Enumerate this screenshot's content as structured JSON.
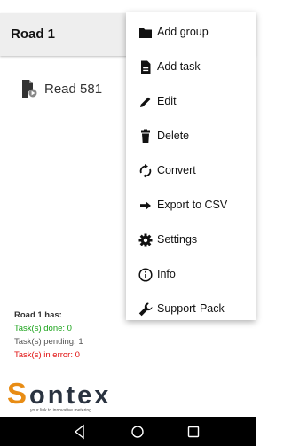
{
  "header": {
    "title": "Road 1"
  },
  "list": {
    "items": [
      {
        "label": "Read 581",
        "icon": "file-play-icon"
      }
    ]
  },
  "summary": {
    "heading": "Road 1  has:",
    "done": "Task(s) done: 0",
    "pending": "Task(s) pending: 1",
    "error": "Task(s) in error: 0"
  },
  "logo": {
    "text": "ontex",
    "letter": "S",
    "tagline": "your link to innovative metering"
  },
  "menu": {
    "items": [
      {
        "label": "Add group",
        "icon": "folder-icon"
      },
      {
        "label": "Add task",
        "icon": "file-icon"
      },
      {
        "label": "Edit",
        "icon": "pencil-icon"
      },
      {
        "label": "Delete",
        "icon": "trash-icon"
      },
      {
        "label": "Convert",
        "icon": "refresh-icon"
      },
      {
        "label": "Export to CSV",
        "icon": "arrow-right-icon"
      },
      {
        "label": "Settings",
        "icon": "gear-icon"
      },
      {
        "label": "Info",
        "icon": "info-icon"
      },
      {
        "label": "Support-Pack",
        "icon": "wrench-icon"
      }
    ]
  },
  "colors": {
    "done": "#1aa31a",
    "error": "#e01010",
    "logo_accent": "#e88c14"
  }
}
